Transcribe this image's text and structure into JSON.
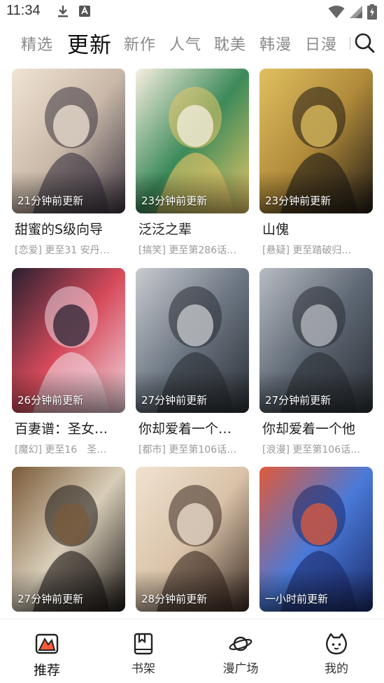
{
  "status_bar": {
    "time": "11:34",
    "left_icons": [
      "download-icon",
      "app-notification-icon"
    ],
    "right_icons": [
      "wifi-icon",
      "cell-signal-icon",
      "battery-charging-icon"
    ]
  },
  "tabs": [
    {
      "label": "精选",
      "active": false
    },
    {
      "label": "更新",
      "active": true
    },
    {
      "label": "新作",
      "active": false
    },
    {
      "label": "人气",
      "active": false
    },
    {
      "label": "耽美",
      "active": false
    },
    {
      "label": "韩漫",
      "active": false
    },
    {
      "label": "日漫",
      "active": false
    }
  ],
  "search_icon": "search-icon",
  "comics": [
    {
      "title": "甜蜜的S级向导",
      "subtitle": "[恋爱] 更至31 安丹…",
      "badge": "21分钟前更新",
      "cover_colors": [
        "#3b3440",
        "#c9b8a8",
        "#f1e4d4"
      ]
    },
    {
      "title": "泛泛之辈",
      "subtitle": "[搞笑] 更至第286话…",
      "badge": "23分钟前更新",
      "cover_colors": [
        "#e8c766",
        "#3c8a5a",
        "#f7efe0"
      ]
    },
    {
      "title": "山傀",
      "subtitle": "[悬疑] 更至踏破归…",
      "badge": "23分钟前更新",
      "cover_colors": [
        "#1f1a14",
        "#b08a3a",
        "#e0c060"
      ]
    },
    {
      "title": "百妻谱：圣女…",
      "subtitle": "[魔幻] 更至16　圣…",
      "badge": "26分钟前更新",
      "cover_colors": [
        "#f2d6e0",
        "#d64a5a",
        "#2a2030"
      ]
    },
    {
      "title": "你却爱着一个…",
      "subtitle": "[都市] 更至第106话…",
      "badge": "27分钟前更新",
      "cover_colors": [
        "#2a2e34",
        "#6c7682",
        "#c9ccd0"
      ]
    },
    {
      "title": "你却爱着一个他",
      "subtitle": "[浪漫] 更至第106话…",
      "badge": "27分钟前更新",
      "cover_colors": [
        "#2a2e34",
        "#5e6874",
        "#b8bcc2"
      ]
    },
    {
      "title": "",
      "subtitle": "",
      "badge": "27分钟前更新",
      "cover_colors": [
        "#1c1815",
        "#d8cdb8",
        "#7a5a38"
      ]
    },
    {
      "title": "",
      "subtitle": "",
      "badge": "28分钟前更新",
      "cover_colors": [
        "#3a2a22",
        "#d9c2a8",
        "#f0e2d0"
      ]
    },
    {
      "title": "",
      "subtitle": "",
      "badge": "一小时前更新",
      "cover_colors": [
        "#1a2a6a",
        "#4a7ad8",
        "#e05a3a"
      ]
    }
  ],
  "bottom_nav": [
    {
      "label": "推荐",
      "icon": "recommend-icon",
      "active": true
    },
    {
      "label": "书架",
      "icon": "bookshelf-icon",
      "active": false
    },
    {
      "label": "漫广场",
      "icon": "planet-icon",
      "active": false
    },
    {
      "label": "我的",
      "icon": "profile-icon",
      "active": false
    }
  ],
  "colors": {
    "accent": "#ff5a3c",
    "text_primary": "#1e1e1e",
    "text_secondary": "#9a9a9a",
    "tab_inactive": "#8a8a8a"
  }
}
